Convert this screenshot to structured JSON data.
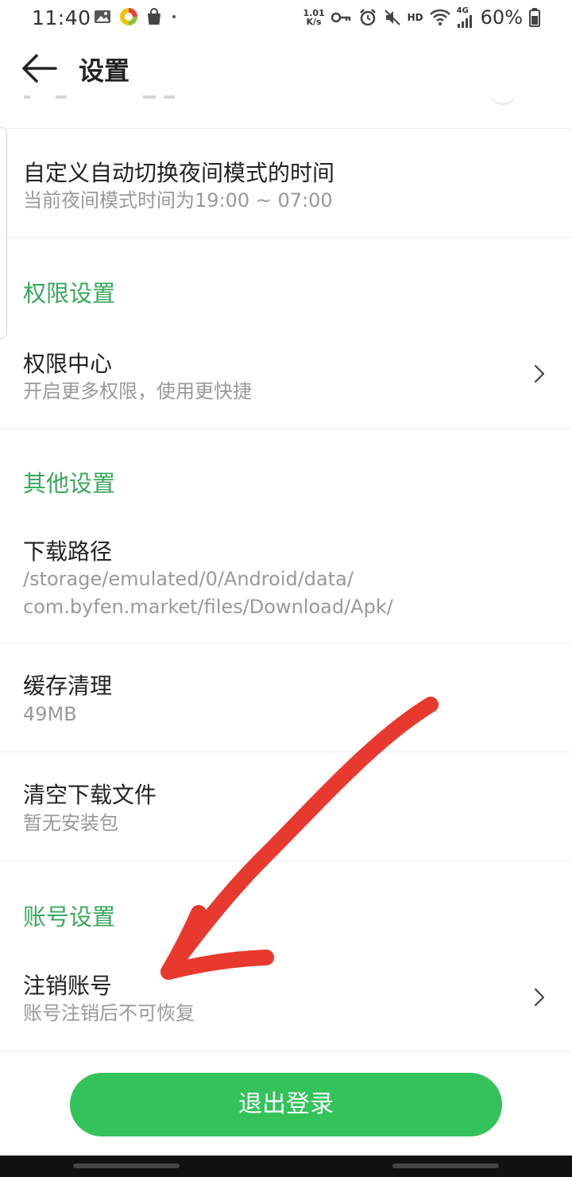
{
  "status_bar": {
    "time": "11:40",
    "net_speed_value": "1.01",
    "net_speed_unit": "K/s",
    "hd": "HD",
    "signal_type": "4G",
    "battery": "60%"
  },
  "header": {
    "title": "设置"
  },
  "items": [
    {
      "title": "自定义自动切换夜间模式的时间",
      "subtitle": "当前夜间模式时间为19:00 ~ 07:00"
    },
    {
      "title": "权限中心",
      "subtitle": "开启更多权限，使用更快捷"
    },
    {
      "title": "下载路径",
      "subtitle_line1": "/storage/emulated/0/Android/data/",
      "subtitle_line2": "com.byfen.market/files/Download/Apk/"
    },
    {
      "title": "缓存清理",
      "subtitle": "49MB"
    },
    {
      "title": "清空下载文件",
      "subtitle": "暂无安装包"
    },
    {
      "title": "注销账号",
      "subtitle": "账号注销后不可恢复"
    }
  ],
  "sections": {
    "permissions": "权限设置",
    "other": "其他设置",
    "account": "账号设置"
  },
  "logout_label": "退出登录",
  "colors": {
    "accent_green": "#3aa85c",
    "button_green": "#34c25a",
    "annotation_red": "#e8392e"
  },
  "icons": {
    "back": "arrow-left-icon",
    "chevron": "chevron-right-icon"
  }
}
